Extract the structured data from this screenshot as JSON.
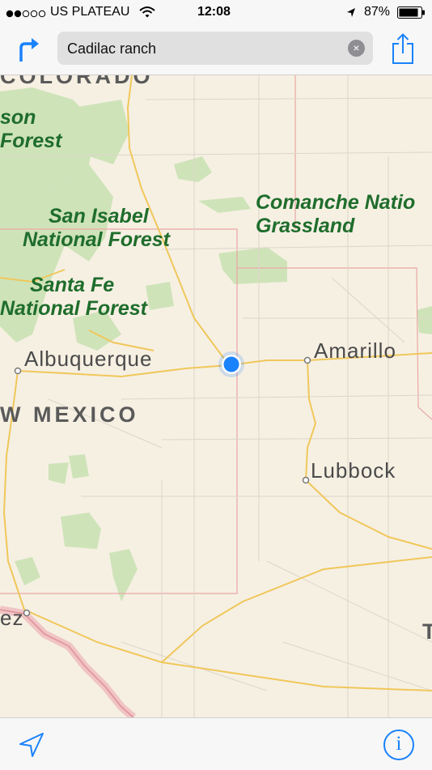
{
  "status_bar": {
    "carrier": "US PLATEAU",
    "time": "12:08",
    "battery": "87%",
    "signal_dots_filled": 2,
    "signal_dots_total": 5
  },
  "toolbar": {
    "search_value": "Cadilac ranch",
    "clear_symbol": "×",
    "directions_icon": "turn-right-arrow-icon",
    "share_icon": "share-icon"
  },
  "map": {
    "state_labels": [
      "COLORADO",
      "W MEXICO"
    ],
    "forest_labels": {
      "top_left_1": "son",
      "top_left_2": "Forest",
      "san_isabel_1": "San Isabel",
      "san_isabel_2": "National Forest",
      "santa_fe_1": "Santa Fe",
      "santa_fe_2": "National Forest",
      "comanche_1": "Comanche Natio",
      "comanche_2": "Grassland"
    },
    "cities": [
      "Albuquerque",
      "Amarillo",
      "Lubbock",
      "ez"
    ],
    "partial_labels": [
      "T"
    ],
    "colors": {
      "land": "#f6f0e3",
      "forest": "#cfe3b9",
      "road": "#f0c75a",
      "border": "#e9a7a4",
      "label_forest": "#1f6d2c",
      "user_location": "#1a82fb"
    }
  },
  "bottom_bar": {
    "location_icon": "location-arrow-icon",
    "info_icon": "info-icon",
    "info_symbol": "i"
  },
  "accent_color": "#1a82fb"
}
